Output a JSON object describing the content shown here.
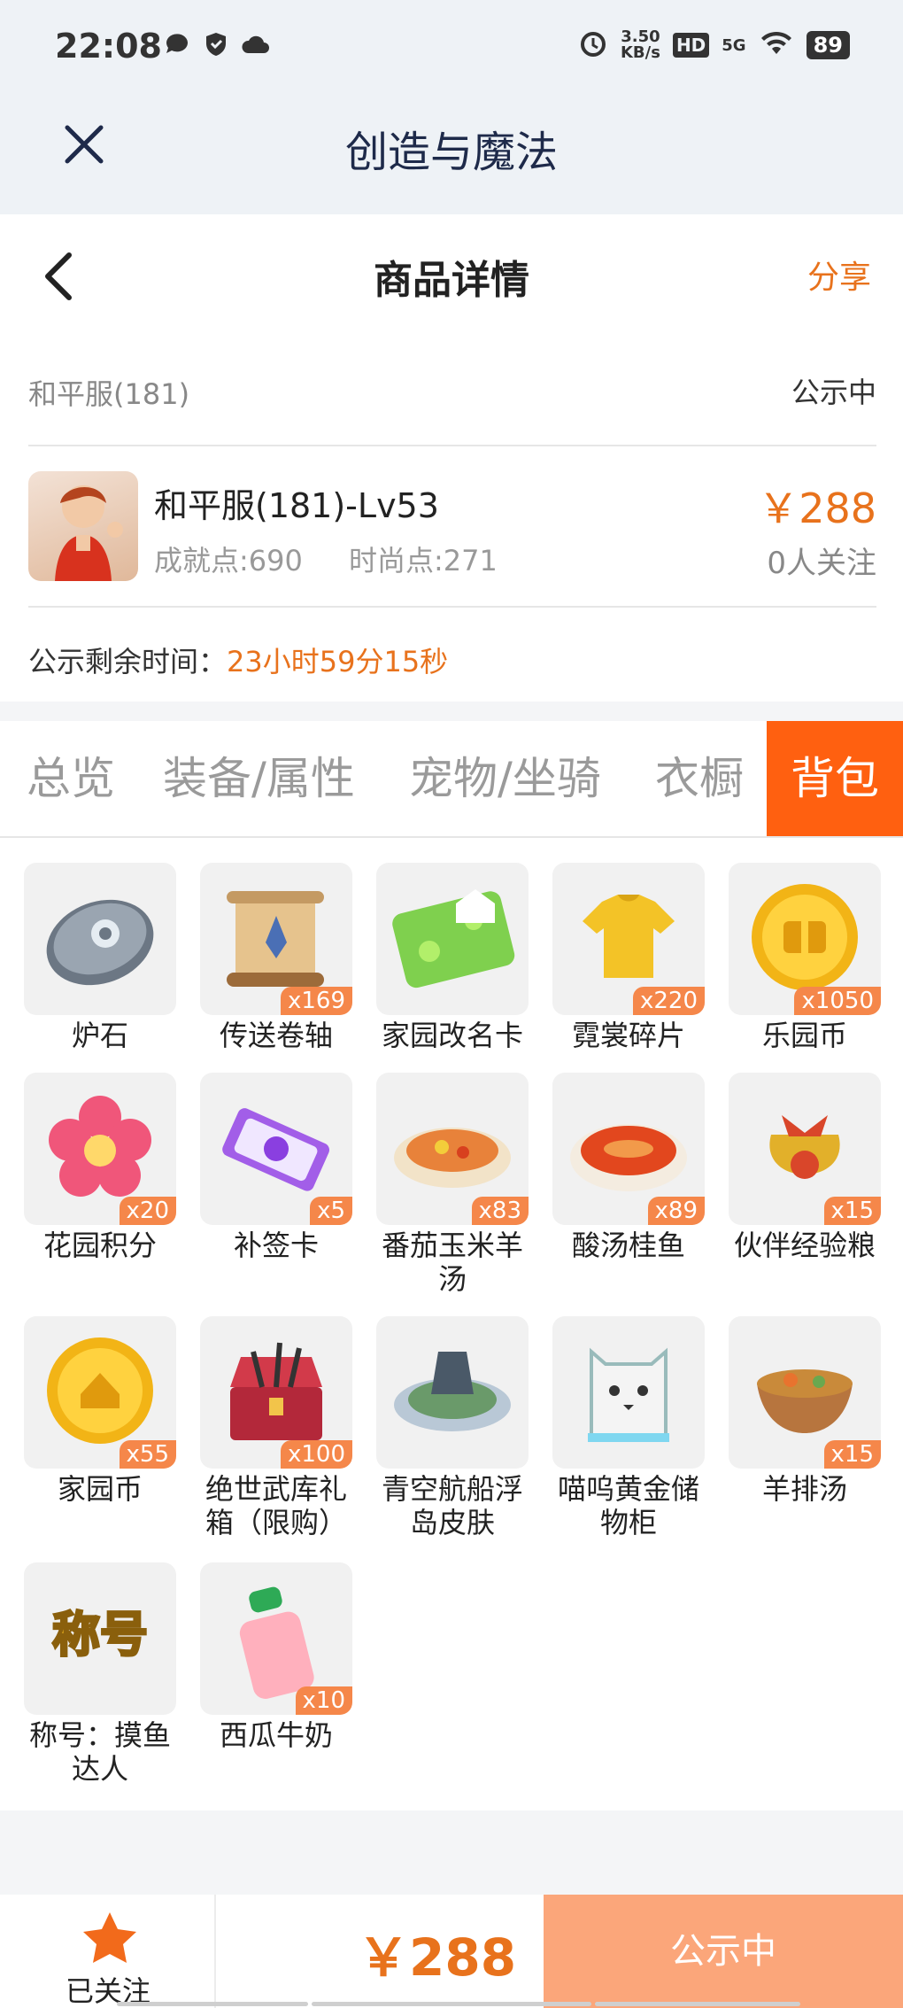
{
  "status_bar": {
    "time": "22:08",
    "net_speed_value": "3.50",
    "net_speed_unit": "KB/s",
    "hd": "HD",
    "network": "5G",
    "battery": "89"
  },
  "app_header": {
    "title": "创造与魔法"
  },
  "page_header": {
    "title": "商品详情",
    "share": "分享"
  },
  "info": {
    "server": "和平服(181)",
    "status": "公示中",
    "name": "和平服(181)-Lv53",
    "achievement": "成就点:690",
    "fashion": "时尚点:271",
    "price": "￥288",
    "followers": "0人关注",
    "timer_label": "公示剩余时间：",
    "timer_value": "23小时59分15秒"
  },
  "tabs": [
    "总览",
    "装备/属性",
    "宠物/坐骑",
    "衣橱",
    "背包"
  ],
  "active_tab": "背包",
  "items": [
    {
      "name": "炉石",
      "qty": "",
      "icon": "hearthstone-icon"
    },
    {
      "name": "传送卷轴",
      "qty": "x169",
      "icon": "scroll-icon"
    },
    {
      "name": "家园改名卡",
      "qty": "",
      "icon": "rename-card-icon"
    },
    {
      "name": "霓裳碎片",
      "qty": "x220",
      "icon": "shirt-fragment-icon"
    },
    {
      "name": "乐园币",
      "qty": "x1050",
      "icon": "park-coin-icon"
    },
    {
      "name": "花园积分",
      "qty": "x20",
      "icon": "flower-icon"
    },
    {
      "name": "补签卡",
      "qty": "x5",
      "icon": "ticket-icon"
    },
    {
      "name": "番茄玉米羊汤",
      "qty": "x83",
      "icon": "tomato-soup-icon"
    },
    {
      "name": "酸汤桂鱼",
      "qty": "x89",
      "icon": "fish-soup-icon"
    },
    {
      "name": "伙伴经验粮",
      "qty": "x15",
      "icon": "pet-food-bag-icon"
    },
    {
      "name": "家园币",
      "qty": "x55",
      "icon": "home-coin-icon"
    },
    {
      "name": "绝世武库礼箱（限购）",
      "qty": "x100",
      "icon": "treasure-chest-icon"
    },
    {
      "name": "青空航船浮岛皮肤",
      "qty": "",
      "icon": "floating-island-icon"
    },
    {
      "name": "喵呜黄金储物柜",
      "qty": "",
      "icon": "cat-cabinet-icon"
    },
    {
      "name": "羊排汤",
      "qty": "x15",
      "icon": "lamb-soup-icon"
    },
    {
      "name": "称号：摸鱼达人",
      "qty": "",
      "icon": "title-badge-icon"
    },
    {
      "name": "西瓜牛奶",
      "qty": "x10",
      "icon": "milk-bottle-icon"
    }
  ],
  "title_badge_text": "称号",
  "bottom_bar": {
    "follow_label": "已关注",
    "price": "￥288",
    "action": "公示中"
  },
  "colors": {
    "accent": "#e8721c",
    "tab_active": "#ff6010",
    "action_button": "#fba67a"
  }
}
